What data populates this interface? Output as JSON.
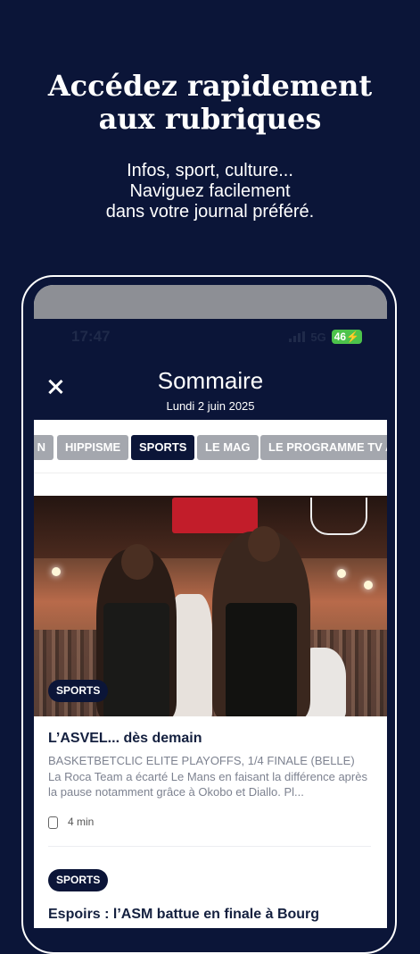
{
  "promo": {
    "title_line1": "Accédez rapidement",
    "title_line2": "aux rubriques",
    "subtitle_line1": "Infos, sport, culture...",
    "subtitle_line2": "Naviguez facilement",
    "subtitle_line3": "dans votre journal préféré."
  },
  "status_bar": {
    "time": "17:47",
    "network": "5G",
    "battery": "46"
  },
  "header": {
    "title": "Sommaire",
    "date": "Lundi 2 juin 2025"
  },
  "tabs": [
    {
      "label": "N",
      "active": false
    },
    {
      "label": "HIPPISME",
      "active": false
    },
    {
      "label": "SPORTS",
      "active": true
    },
    {
      "label": "LE MAG",
      "active": false
    },
    {
      "label": "LE PROGRAMME TV AV",
      "active": false
    }
  ],
  "article1": {
    "category": "SPORTS",
    "title": "L’ASVEL... dès demain",
    "kicker": "BASKETBETCLIC ELITE PLAYOFFS, 1/4 FINALE (BELLE)",
    "excerpt": "La Roca Team a écarté Le Mans en faisant la différence après la pause notamment grâce à Okobo et Diallo. Pl...",
    "read_time": "4 min"
  },
  "article2": {
    "category": "SPORTS",
    "title": "Espoirs : l’ASM battue en finale à Bourg"
  },
  "colors": {
    "navy": "#0b1538",
    "tab_inactive": "#a4a7ae",
    "battery": "#4cc34b"
  }
}
